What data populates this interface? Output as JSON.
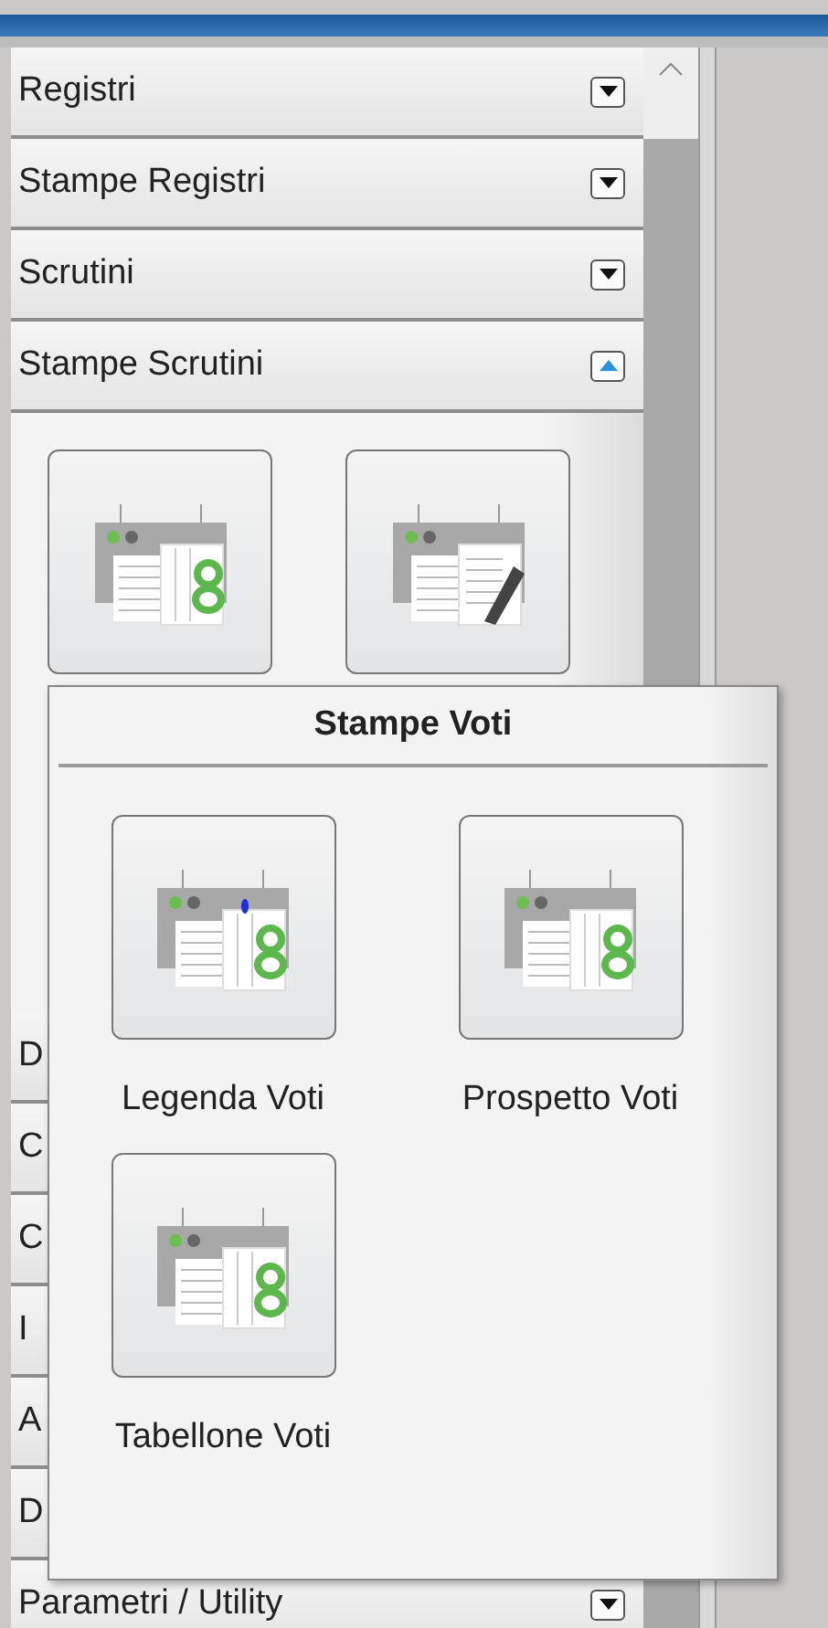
{
  "sections": [
    {
      "title": "Registri",
      "expanded": false
    },
    {
      "title": "Stampe Registri",
      "expanded": false
    },
    {
      "title": "Scrutini",
      "expanded": false
    },
    {
      "title": "Stampe Scrutini",
      "expanded": true,
      "buttons": [
        {
          "kind": "grades"
        },
        {
          "kind": "edit"
        }
      ]
    },
    {
      "title": "D"
    },
    {
      "title": "C"
    },
    {
      "title": "C"
    },
    {
      "title": "I"
    },
    {
      "title": "A"
    },
    {
      "title": "D"
    },
    {
      "title": "Parametri / Utility",
      "expanded": false
    }
  ],
  "popup": {
    "title": "Stampe Voti",
    "items": [
      {
        "label": "Legenda Voti",
        "kind": "marked"
      },
      {
        "label": "Prospetto Voti",
        "kind": "grades"
      },
      {
        "label": "Tabellone Voti",
        "kind": "grades"
      }
    ]
  }
}
